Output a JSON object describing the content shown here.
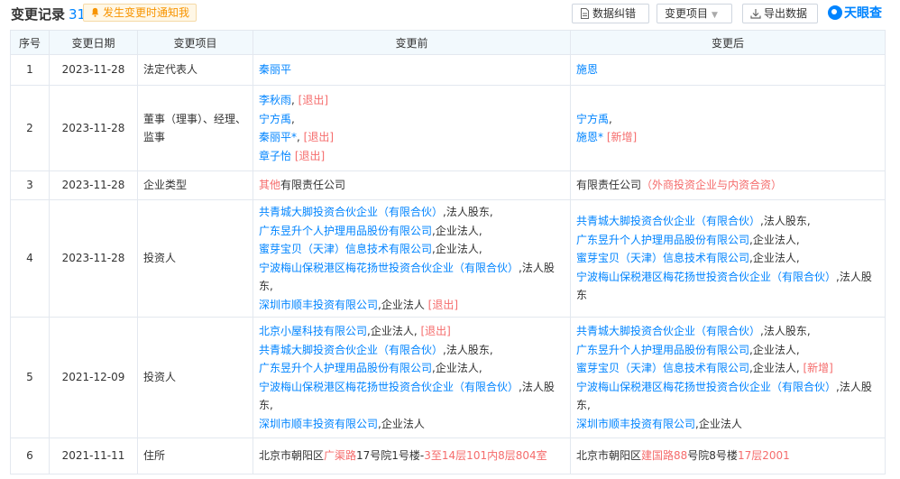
{
  "header": {
    "title": "变更记录",
    "count": "31",
    "notify_label": "发生变更时通知我",
    "btn_correct": "数据纠错",
    "btn_items": "变更项目",
    "btn_export": "导出数据",
    "logo_text": "天眼查"
  },
  "table": {
    "columns": [
      "序号",
      "变更日期",
      "变更项目",
      "变更前",
      "变更后"
    ],
    "rows": [
      {
        "no": "1",
        "date": "2023-11-28",
        "item": "法定代表人",
        "before": [
          [
            {
              "t": "秦丽平",
              "c": "lnk"
            }
          ]
        ],
        "after": [
          [
            {
              "t": "施恩",
              "c": "lnk"
            }
          ]
        ]
      },
      {
        "no": "2",
        "date": "2023-11-28",
        "item": "董事（理事）、经理、监事",
        "before": [
          [
            {
              "t": "李秋雨",
              "c": "lnk"
            },
            {
              "t": ", ",
              "c": "plain"
            },
            {
              "t": "[退出]",
              "c": "tag"
            }
          ],
          [
            {
              "t": "宁方禹",
              "c": "lnk"
            },
            {
              "t": ",",
              "c": "plain"
            }
          ],
          [
            {
              "t": "秦丽平*",
              "c": "lnk"
            },
            {
              "t": ", ",
              "c": "plain"
            },
            {
              "t": "[退出]",
              "c": "tag"
            }
          ],
          [
            {
              "t": "章子怡",
              "c": "lnk"
            },
            {
              "t": " ",
              "c": "plain"
            },
            {
              "t": "[退出]",
              "c": "tag"
            }
          ]
        ],
        "after": [
          [
            {
              "t": "宁方禹",
              "c": "lnk"
            },
            {
              "t": ",",
              "c": "plain"
            }
          ],
          [
            {
              "t": "施恩*",
              "c": "lnk"
            },
            {
              "t": " ",
              "c": "plain"
            },
            {
              "t": "[新增]",
              "c": "tag"
            }
          ]
        ]
      },
      {
        "no": "3",
        "date": "2023-11-28",
        "item": "企业类型",
        "before": [
          [
            {
              "t": "其他",
              "c": "red"
            },
            {
              "t": "有限责任公司",
              "c": "plain"
            }
          ]
        ],
        "after": [
          [
            {
              "t": "有限责任公司",
              "c": "plain"
            },
            {
              "t": "（外商投资企业与内资合资）",
              "c": "red"
            }
          ]
        ]
      },
      {
        "no": "4",
        "date": "2023-11-28",
        "item": "投资人",
        "before": [
          [
            {
              "t": "共青城大脚投资合伙企业（有限合伙）",
              "c": "lnk"
            },
            {
              "t": ",法人股东,",
              "c": "plain"
            }
          ],
          [
            {
              "t": "广东昱升个人护理用品股份有限公司",
              "c": "lnk"
            },
            {
              "t": ",企业法人,",
              "c": "plain"
            }
          ],
          [
            {
              "t": "蜜芽宝贝（天津）信息技术有限公司",
              "c": "lnk"
            },
            {
              "t": ",企业法人,",
              "c": "plain"
            }
          ],
          [
            {
              "t": "宁波梅山保税港区梅花扬世投资合伙企业（有限合伙）",
              "c": "lnk"
            },
            {
              "t": ",法人股东,",
              "c": "plain"
            }
          ],
          [
            {
              "t": "深圳市顺丰投资有限公司",
              "c": "lnk"
            },
            {
              "t": ",企业法人 ",
              "c": "plain"
            },
            {
              "t": "[退出]",
              "c": "tag"
            }
          ]
        ],
        "after": [
          [
            {
              "t": "共青城大脚投资合伙企业（有限合伙）",
              "c": "lnk"
            },
            {
              "t": ",法人股东,",
              "c": "plain"
            }
          ],
          [
            {
              "t": "广东昱升个人护理用品股份有限公司",
              "c": "lnk"
            },
            {
              "t": ",企业法人,",
              "c": "plain"
            }
          ],
          [
            {
              "t": "蜜芽宝贝（天津）信息技术有限公司",
              "c": "lnk"
            },
            {
              "t": ",企业法人,",
              "c": "plain"
            }
          ],
          [
            {
              "t": "宁波梅山保税港区梅花扬世投资合伙企业（有限合伙）",
              "c": "lnk"
            },
            {
              "t": ",法人股东",
              "c": "plain"
            }
          ]
        ]
      },
      {
        "no": "5",
        "date": "2021-12-09",
        "item": "投资人",
        "before": [
          [
            {
              "t": "北京小屋科技有限公司",
              "c": "lnk"
            },
            {
              "t": ",企业法人, ",
              "c": "plain"
            },
            {
              "t": "[退出]",
              "c": "tag"
            }
          ],
          [
            {
              "t": "共青城大脚投资合伙企业（有限合伙）",
              "c": "lnk"
            },
            {
              "t": ",法人股东,",
              "c": "plain"
            }
          ],
          [
            {
              "t": "广东昱升个人护理用品股份有限公司",
              "c": "lnk"
            },
            {
              "t": ",企业法人,",
              "c": "plain"
            }
          ],
          [
            {
              "t": "宁波梅山保税港区梅花扬世投资合伙企业（有限合伙）",
              "c": "lnk"
            },
            {
              "t": ",法人股东,",
              "c": "plain"
            }
          ],
          [
            {
              "t": "深圳市顺丰投资有限公司",
              "c": "lnk"
            },
            {
              "t": ",企业法人",
              "c": "plain"
            }
          ]
        ],
        "after": [
          [
            {
              "t": "共青城大脚投资合伙企业（有限合伙）",
              "c": "lnk"
            },
            {
              "t": ",法人股东,",
              "c": "plain"
            }
          ],
          [
            {
              "t": "广东昱升个人护理用品股份有限公司",
              "c": "lnk"
            },
            {
              "t": ",企业法人,",
              "c": "plain"
            }
          ],
          [
            {
              "t": "蜜芽宝贝（天津）信息技术有限公司",
              "c": "lnk"
            },
            {
              "t": ",企业法人, ",
              "c": "plain"
            },
            {
              "t": "[新增]",
              "c": "tag"
            }
          ],
          [
            {
              "t": "宁波梅山保税港区梅花扬世投资合伙企业（有限合伙）",
              "c": "lnk"
            },
            {
              "t": ",法人股东,",
              "c": "plain"
            }
          ],
          [
            {
              "t": "深圳市顺丰投资有限公司",
              "c": "lnk"
            },
            {
              "t": ",企业法人",
              "c": "plain"
            }
          ]
        ]
      },
      {
        "no": "6",
        "date": "2021-11-11",
        "item": "住所",
        "before": [
          [
            {
              "t": "北京市朝阳区",
              "c": "plain"
            },
            {
              "t": "广渠路",
              "c": "red"
            },
            {
              "t": "17号院1号楼-",
              "c": "plain"
            },
            {
              "t": "3至14层101内8层804室",
              "c": "red"
            }
          ]
        ],
        "after": [
          [
            {
              "t": "北京市朝阳区",
              "c": "plain"
            },
            {
              "t": "建国路88",
              "c": "red"
            },
            {
              "t": "号院8号楼",
              "c": "plain"
            },
            {
              "t": "17层2001",
              "c": "red"
            }
          ]
        ]
      }
    ]
  },
  "colors": {
    "accent": "#0084ff",
    "warn": "#f79400",
    "red": "#f56c6c",
    "header_bg": "#f2f9fd",
    "border": "#e3e8ef"
  },
  "icons": {
    "notify": "bell-icon",
    "correct": "document-icon",
    "items_caret": "caret-down-icon",
    "export": "download-icon",
    "logo": "tianyancha-logo-icon"
  }
}
